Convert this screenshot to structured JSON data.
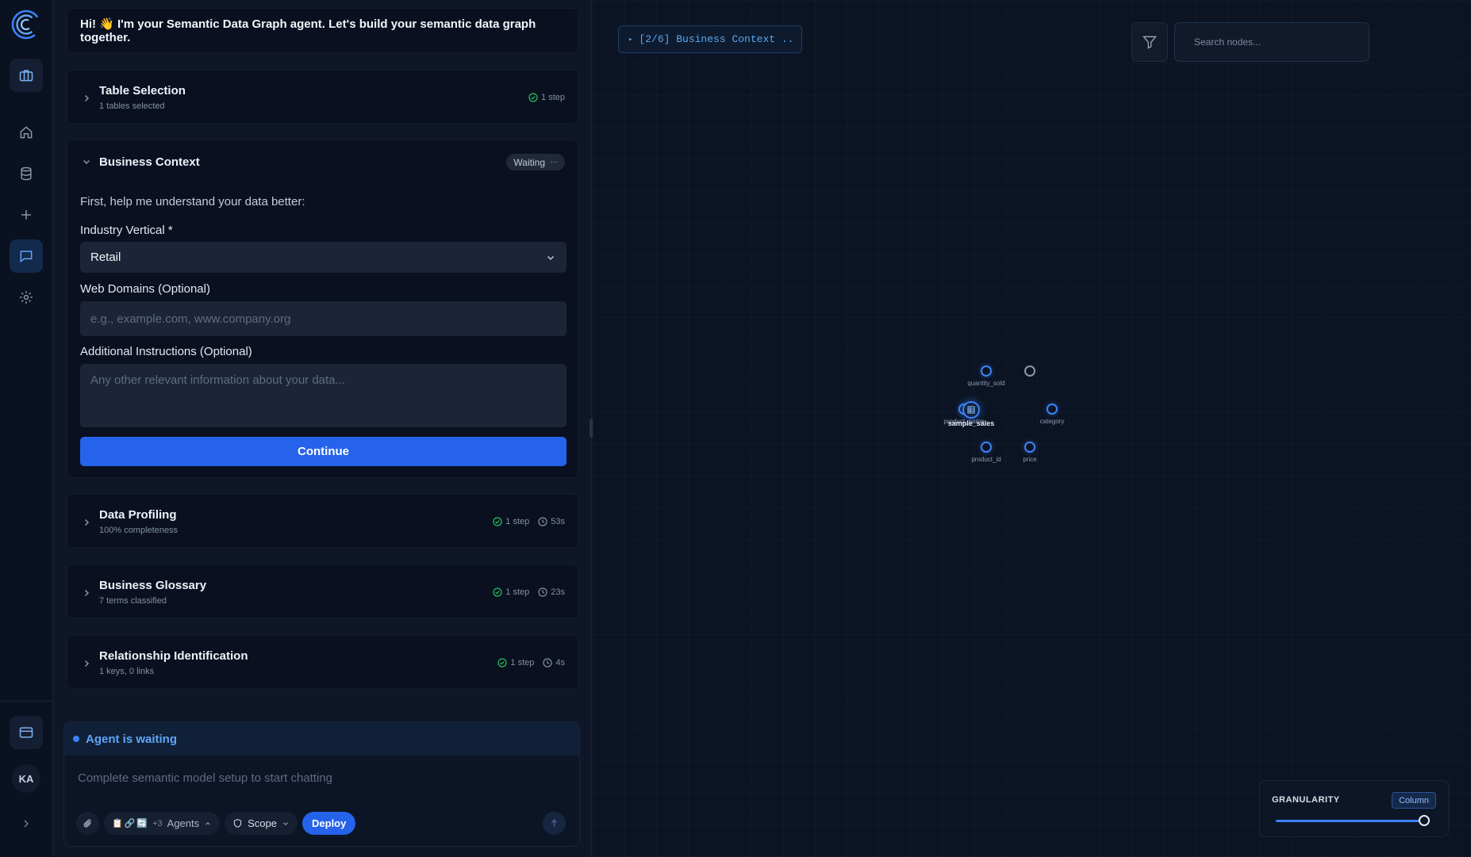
{
  "rail": {
    "logo_icon": "app-logo",
    "top_icon": "briefcase-icon",
    "nav": [
      {
        "name": "home-icon"
      },
      {
        "name": "database-icon"
      },
      {
        "name": "plus-icon"
      },
      {
        "name": "chat-icon",
        "active": true
      },
      {
        "name": "gear-icon"
      }
    ],
    "billing_icon": "credit-card-icon",
    "avatar_initials": "KA",
    "expand_icon": "chevron-right-icon"
  },
  "chat": {
    "greeting": "Hi! 👋 I'm your Semantic Data Graph agent. Let's build your semantic data graph together.",
    "steps_before": [
      {
        "title": "Table Selection",
        "subtitle": "1 tables selected",
        "steps": "1 step"
      }
    ],
    "business_context": {
      "title": "Business Context",
      "status": "Waiting",
      "intro": "First, help me understand your data better:",
      "industry_label": "Industry Vertical *",
      "industry_value": "Retail",
      "web_label": "Web Domains (Optional)",
      "web_placeholder": "e.g., example.com, www.company.org",
      "instructions_label": "Additional Instructions (Optional)",
      "instructions_placeholder": "Any other relevant information about your data...",
      "continue_label": "Continue"
    },
    "steps_after": [
      {
        "title": "Data Profiling",
        "subtitle": "100% completeness",
        "steps": "1 step",
        "duration": "53s"
      },
      {
        "title": "Business Glossary",
        "subtitle": "7 terms classified",
        "steps": "1 step",
        "duration": "23s"
      },
      {
        "title": "Relationship Identification",
        "subtitle": "1 keys, 0 links",
        "steps": "1 step",
        "duration": "4s"
      }
    ],
    "agent_status": "Agent is waiting",
    "input_placeholder": "Complete semantic model setup to start chatting",
    "agents_extra": "+3",
    "agents_label": "Agents",
    "scope_label": "Scope",
    "deploy_label": "Deploy"
  },
  "graph": {
    "stage": "[2/6] Business Context ..",
    "search_placeholder": "Search nodes...",
    "center_node": "sample_sales",
    "nodes": [
      {
        "label": "quantity_sold"
      },
      {
        "label": ""
      },
      {
        "label": "product_name"
      },
      {
        "label": "category"
      },
      {
        "label": "product_id"
      },
      {
        "label": "price"
      }
    ],
    "granularity": {
      "title": "GRANULARITY",
      "value": "Column",
      "level": 1.0
    }
  },
  "colors": {
    "accent": "#2563eb",
    "node": "#3b82f6",
    "success": "#22c55e"
  }
}
